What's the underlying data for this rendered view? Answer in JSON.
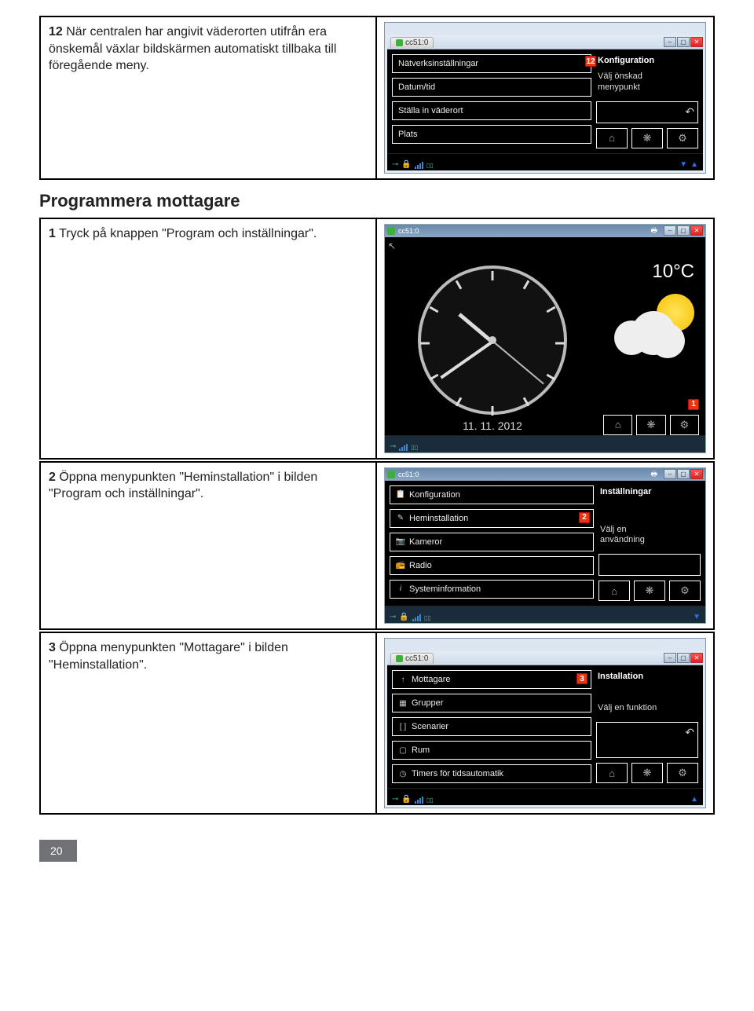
{
  "step12": {
    "num": "12",
    "text": " När centralen har angivit väderorten utifrån era önskemål växlar bildskärmen automatiskt tillbaka till föregående meny.",
    "tab": "cc51:0",
    "menu": {
      "item1": "Nätverksinställningar",
      "item2": "Datum/tid",
      "item3": "Ställa in väderort",
      "item4": "Plats"
    },
    "side_title": "Konfiguration",
    "side_sub1": "Välj önskad",
    "side_sub2": "menypunkt",
    "marker": "12",
    "icons": {
      "back": "↶",
      "home": "⌂",
      "fan": "❋",
      "gear": "⚙"
    }
  },
  "section_title": "Programmera mottagare",
  "step1": {
    "num": "1",
    "text": " Tryck på knappen \"Program och inställningar\".",
    "tab": "cc51:0",
    "temp": "10°C",
    "date": "11. 11. 2012",
    "marker": "1",
    "icons": {
      "home": "⌂",
      "fan": "❋",
      "gear": "⚙"
    }
  },
  "step2": {
    "num": "2",
    "text": " Öppna menypunkten \"Heminstallation\" i bilden \"Program och inställningar\".",
    "tab": "cc51:0",
    "menu": {
      "item1": "Konfiguration",
      "item2": "Heminstallation",
      "item3": "Kameror",
      "item4": "Radio",
      "item5": "Systeminformation"
    },
    "side_title": "Inställningar",
    "side_sub1": "Välj en",
    "side_sub2": "användning",
    "marker": "2",
    "icons": {
      "home": "⌂",
      "fan": "❋",
      "gear": "⚙"
    }
  },
  "step3": {
    "num": "3",
    "text": " Öppna menypunkten \"Mottagare\" i bilden \"Heminstallation\".",
    "tab": "cc51:0",
    "menu": {
      "item1": "Mottagare",
      "item2": "Grupper",
      "item3": "Scenarier",
      "item4": "Rum",
      "item5": "Timers för tidsautomatik"
    },
    "side_title": "Installation",
    "side_sub1": "Välj en funktion",
    "marker": "3",
    "icons": {
      "back": "↶",
      "home": "⌂",
      "fan": "❋",
      "gear": "⚙"
    }
  },
  "page_number": "20"
}
